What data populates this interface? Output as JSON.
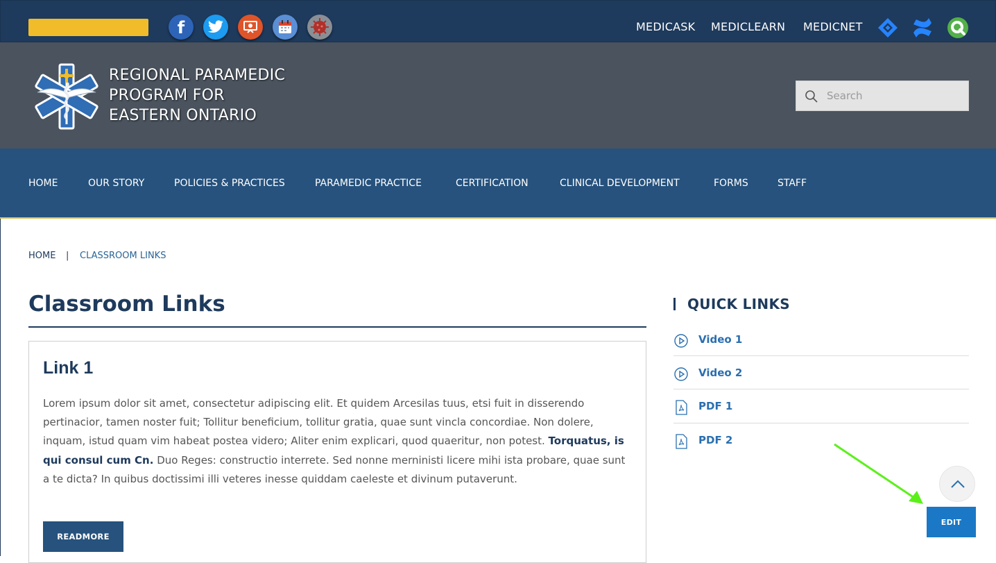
{
  "topbar": {
    "social_icons": [
      "facebook-icon",
      "twitter-icon",
      "presentation-icon",
      "calendar-icon",
      "covid-icon"
    ],
    "links": [
      "MEDICASK",
      "MEDICLEARN",
      "MEDICNET"
    ],
    "app_icons": [
      "jira-icon",
      "confluence-icon",
      "qlik-icon"
    ]
  },
  "header": {
    "logo_lines": [
      "REGIONAL PARAMEDIC",
      "PROGRAM FOR",
      "EASTERN ONTARIO"
    ],
    "search_placeholder": "Search"
  },
  "nav": {
    "items": [
      "HOME",
      "OUR STORY",
      "POLICIES & PRACTICES",
      "PARAMEDIC PRACTICE",
      "CERTIFICATION",
      "CLINICAL DEVELOPMENT",
      "FORMS",
      "STAFF"
    ]
  },
  "breadcrumb": {
    "home": "HOME",
    "separator": "|",
    "current": "CLASSROOM LINKS"
  },
  "main": {
    "title": "Classroom Links",
    "card": {
      "title": "Link 1",
      "body_1": "Lorem ipsum dolor sit amet, consectetur adipiscing elit. Et quidem Arcesilas tuus, etsi fuit in disserendo pertinacior, tamen noster fuit; Tollitur beneficium, tollitur gratia, quae sunt vincla concordiae. Non dolere, inquam, istud quam vim habeat postea videro; Aliter enim explicari, quod quaeritur, non potest. ",
      "body_bold": "Torquatus, is qui consul cum Cn.",
      "body_2": " Duo Reges: constructio interrete. Sed nonne merninisti licere mihi ista probare, quae sunt a te dicta? In quibus doctissimi illi veteres inesse quiddam caeleste et divinum putaverunt.",
      "button": "READMORE"
    }
  },
  "quick_links": {
    "title": "QUICK LINKS",
    "items": [
      {
        "label": "Video 1",
        "icon": "play-circle-icon"
      },
      {
        "label": "Video 2",
        "icon": "play-circle-icon"
      },
      {
        "label": "PDF 1",
        "icon": "pdf-icon"
      },
      {
        "label": "PDF 2",
        "icon": "pdf-icon"
      }
    ]
  },
  "edit_button": "EDIT",
  "colors": {
    "topbar": "#1e3a5c",
    "header": "#4a535e",
    "nav": "#26527d",
    "accent": "#1a78c6",
    "arrow": "#5cf01a"
  }
}
